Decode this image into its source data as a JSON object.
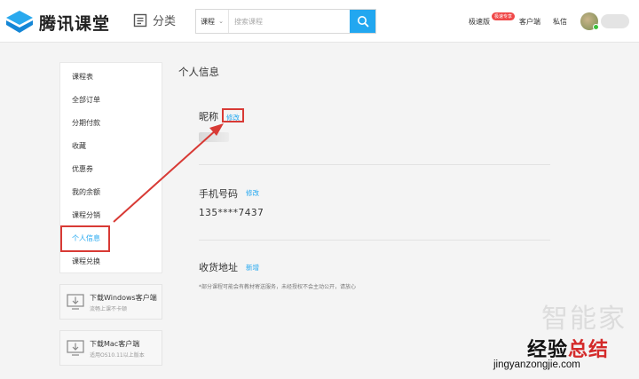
{
  "header": {
    "logo_text": "腾讯课堂",
    "category_label": "分类",
    "search": {
      "type_label": "课程",
      "placeholder": "搜索课程"
    },
    "nav": {
      "speed_label": "极速版",
      "speed_badge": "极速专享",
      "client_label": "客户端",
      "message_label": "私信"
    }
  },
  "sidebar": {
    "items": [
      "课程表",
      "全部订单",
      "分期付款",
      "收藏",
      "优惠券",
      "我的余额",
      "课程分销",
      "个人信息",
      "课程兑换"
    ],
    "active_index": 7
  },
  "downloads": [
    {
      "title": "下载Windows客户端",
      "subtitle": "流畅上课不卡顿"
    },
    {
      "title": "下载Mac客户端",
      "subtitle": "适用OS10.11以上版本"
    }
  ],
  "main": {
    "title": "个人信息",
    "nickname": {
      "label": "昵称",
      "edit_label": "修改"
    },
    "phone": {
      "label": "手机号码",
      "edit_label": "修改",
      "value": "135****7437"
    },
    "address": {
      "label": "收货地址",
      "add_label": "新增",
      "note": "*部分课程可能会有教材寄送服务，未经授权不会主动公开，请放心"
    }
  },
  "watermark": {
    "faded": "智能家",
    "brand_left": "经验",
    "brand_right": "总结",
    "url": "jingyanzongjie.com"
  },
  "colors": {
    "accent": "#22a7f0",
    "highlight": "#d83a35",
    "badge": "#f04848"
  }
}
